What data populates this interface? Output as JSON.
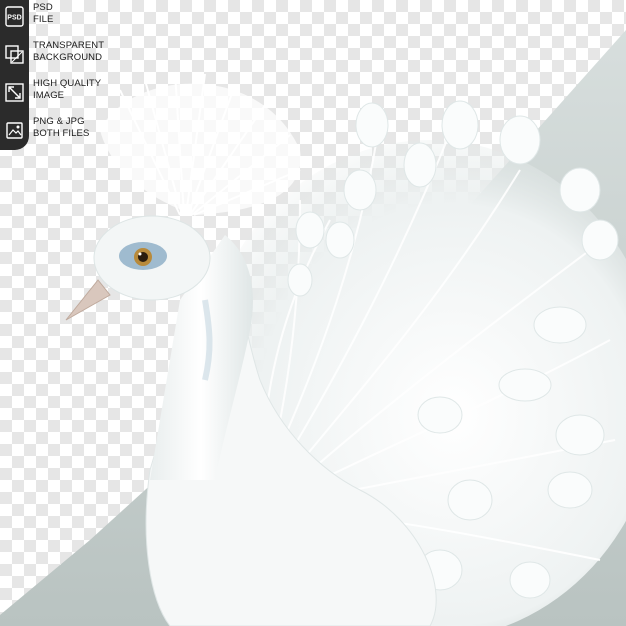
{
  "badges": [
    {
      "icon": "psd-file-icon",
      "line1": "PSD",
      "line2": "FILE",
      "icon_text": "PSD"
    },
    {
      "icon": "layers-icon",
      "line1": "TRANSPARENT",
      "line2": "BACKGROUND"
    },
    {
      "icon": "expand-icon",
      "line1": "HIGH QUALITY",
      "line2": "IMAGE"
    },
    {
      "icon": "image-files-icon",
      "line1": "PNG & JPG",
      "line2": "BOTH FILES"
    }
  ],
  "colors": {
    "badge_strip": "#2b2b2b",
    "backdrop": "#c9d1cf",
    "plumage": "#f4f6f6",
    "eye_ring": "#8fb0c8"
  },
  "photo": {
    "subject": "white-peacock"
  }
}
